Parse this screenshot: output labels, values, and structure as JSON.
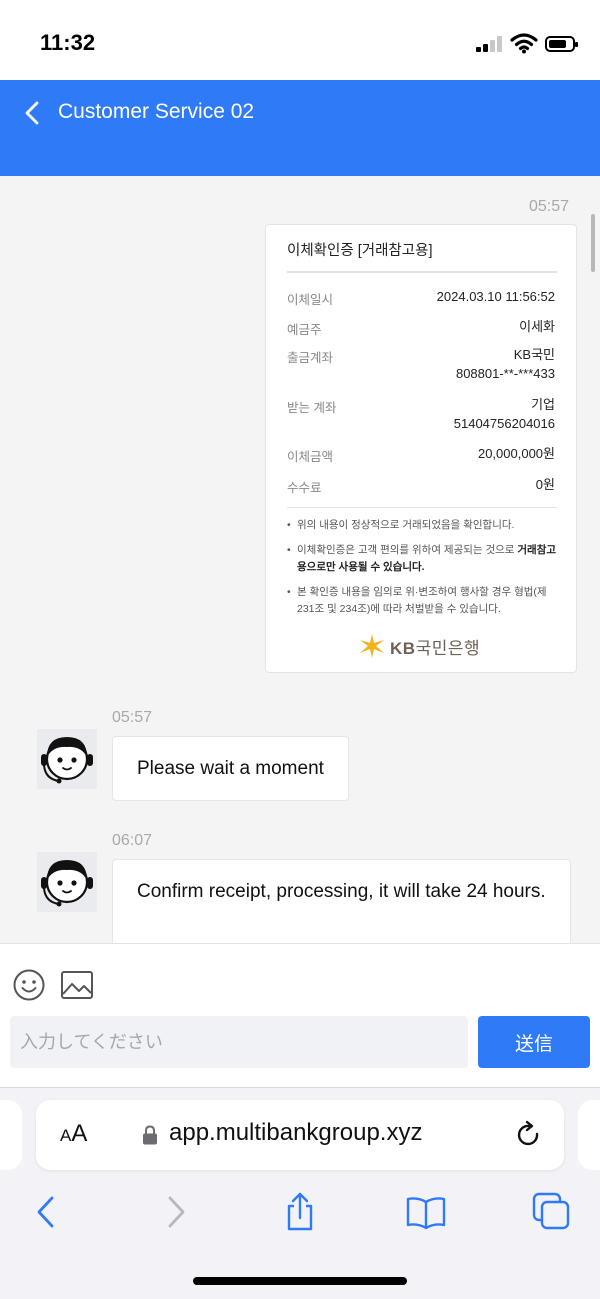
{
  "status_bar": {
    "time": "11:32",
    "battery_level": 0.75
  },
  "header": {
    "title": "Customer Service 02"
  },
  "messages": [
    {
      "time": "05:57",
      "sender": "user",
      "type": "image",
      "receipt": {
        "title": "이체확인증 [거래참고용]",
        "rows": [
          {
            "label": "이체일시",
            "value": "2024.03.10 11:56:52"
          },
          {
            "label": "예금주",
            "value": "이세화"
          },
          {
            "label": "출금계좌",
            "value_line1": "KB국민",
            "value_line2": "808801-**-***433"
          },
          {
            "label": "받는 계좌",
            "value_line1": "기업",
            "value_line2": "51404756204016"
          },
          {
            "label": "이체금액",
            "value": "20,000,000원"
          },
          {
            "label": "수수료",
            "value": "0원"
          }
        ],
        "notes": [
          "위의 내용이 정상적으로 거래되었음을 확인합니다.",
          "이체확인증은 고객 편의를 위하여 제공되는 것으로",
          "거래참고용으로만 사용될 수 있습니다.",
          "본 확인증 내용을 임의로 위·변조하여 행사할 경우 형법(제231조 및 234조)에 따라 처벌받을 수 있습니다."
        ],
        "bank_logo_prefix": "KB",
        "bank_logo_name": "국민은행"
      }
    },
    {
      "time": "05:57",
      "sender": "agent",
      "text": "Please wait a moment"
    },
    {
      "time": "06:07",
      "sender": "agent",
      "text": "Confirm receipt, processing, it will take 24 hours."
    }
  ],
  "composer": {
    "placeholder": "入力してください",
    "send_label": "送信"
  },
  "browser": {
    "aa_label_small": "A",
    "aa_label_large": "A",
    "url": "app.multibankgroup.xyz"
  },
  "colors": {
    "accent": "#2f7af6",
    "chat_bg": "#f4f4f5"
  }
}
